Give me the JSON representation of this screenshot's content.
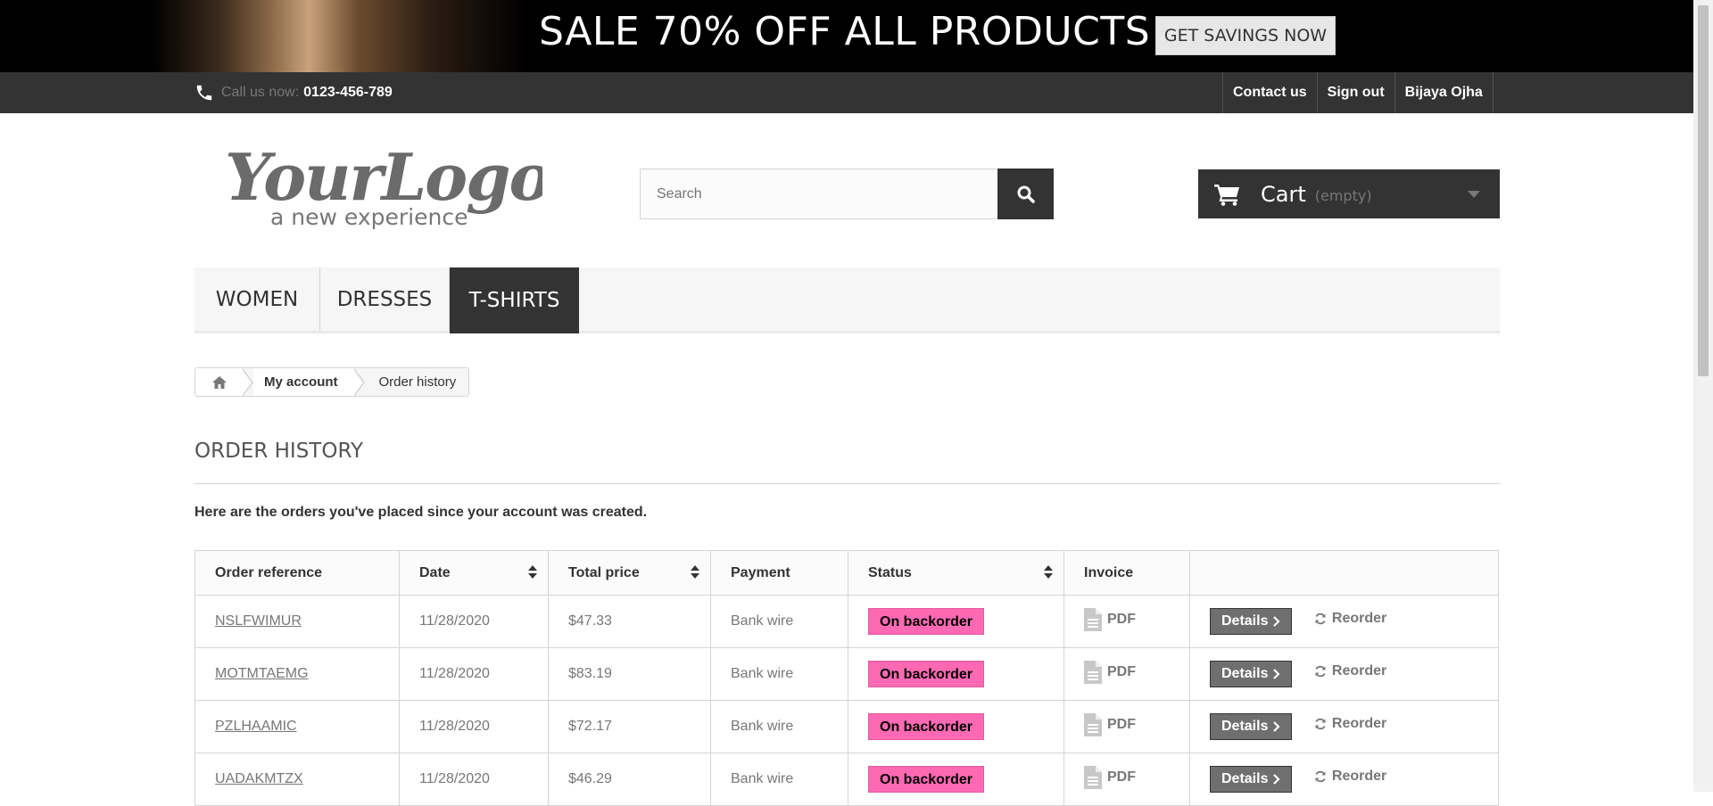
{
  "banner": {
    "headline": "SALE 70% OFF ALL PRODUCTS",
    "cta": "GET SAVINGS NOW"
  },
  "topbar": {
    "call_label": "Call us now:",
    "phone": "0123-456-789",
    "links": [
      "Contact us",
      "Sign out",
      "Bijaya Ojha"
    ]
  },
  "logo": {
    "name": "YourLogo",
    "tagline": "a new experience"
  },
  "search": {
    "placeholder": "Search"
  },
  "cart": {
    "label": "Cart",
    "status": "(empty)"
  },
  "menu": {
    "items": [
      "WOMEN",
      "DRESSES",
      "T-SHIRTS"
    ],
    "active": "T-SHIRTS"
  },
  "breadcrumb": {
    "account": "My account",
    "current": "Order history"
  },
  "page": {
    "title": "ORDER HISTORY",
    "intro": "Here are the orders you've placed since your account was created."
  },
  "orders": {
    "headers": [
      "Order reference",
      "Date",
      "Total price",
      "Payment",
      "Status",
      "Invoice",
      ""
    ],
    "rows": [
      {
        "reference": "NSLFWIMUR",
        "date": "11/28/2020",
        "total": "$47.33",
        "payment": "Bank wire",
        "status": "On backorder",
        "invoice": "PDF",
        "details": "Details",
        "reorder": "Reorder"
      },
      {
        "reference": "MOTMTAEMG",
        "date": "11/28/2020",
        "total": "$83.19",
        "payment": "Bank wire",
        "status": "On backorder",
        "invoice": "PDF",
        "details": "Details",
        "reorder": "Reorder"
      },
      {
        "reference": "PZLHAAMIC",
        "date": "11/28/2020",
        "total": "$72.17",
        "payment": "Bank wire",
        "status": "On backorder",
        "invoice": "PDF",
        "details": "Details",
        "reorder": "Reorder"
      },
      {
        "reference": "UADAKMTZX",
        "date": "11/28/2020",
        "total": "$46.29",
        "payment": "Bank wire",
        "status": "On backorder",
        "invoice": "PDF",
        "details": "Details",
        "reorder": "Reorder"
      }
    ]
  },
  "colors": {
    "dark": "#333333",
    "status_badge": "#ff69b4",
    "menu_bg": "#f6f6f6"
  }
}
